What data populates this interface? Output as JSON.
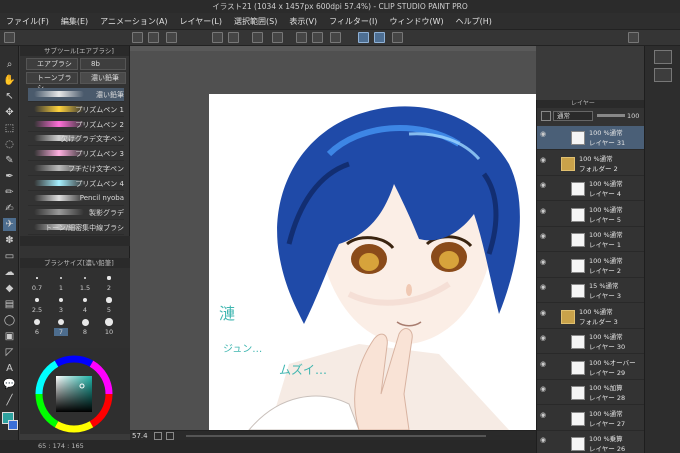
{
  "window": {
    "title": "イラスト21 (1034 x 1457px 600dpi 57.4%) - CLIP STUDIO PAINT PRO"
  },
  "menu": [
    "ファイル(F)",
    "編集(E)",
    "アニメーション(A)",
    "レイヤー(L)",
    "選択範囲(S)",
    "表示(V)",
    "フィルター(I)",
    "ウィンドウ(W)",
    "ヘルプ(H)"
  ],
  "subtool": {
    "header": "サブツール[エアブラシ]",
    "tabs": [
      "エアブラシ",
      "8b",
      "トーンブラシ",
      "濃い鉛筆"
    ],
    "brushes": [
      {
        "name": "濃い鉛筆",
        "selected": true
      },
      {
        "name": "プリズムペン 1"
      },
      {
        "name": "プリズムペン 2"
      },
      {
        "name": "欠けグラデ文字ペン"
      },
      {
        "name": "プリズムペン 3"
      },
      {
        "name": "フチだけ文字ペン"
      },
      {
        "name": "プリズムペン 4"
      },
      {
        "name": "Pencil nyoba"
      },
      {
        "name": "製影グラデ"
      },
      {
        "name": "トーン/細密集中線ブラシ"
      }
    ]
  },
  "brushsize": {
    "header": "ブラシサイズ[濃い鉛筆]",
    "values": [
      "0.7",
      "1",
      "1.5",
      "2",
      "2.5",
      "3",
      "4",
      "5",
      "6",
      "7",
      "8",
      "10"
    ]
  },
  "color": {
    "rgb_readout": "65 : 174 : 165",
    "main_color": "#2ea29f",
    "sub_color": "#3a6fd8"
  },
  "canvas": {
    "zoom": "57.4",
    "handwriting_1": "漣",
    "handwriting_2": "ジュン…",
    "handwriting_3": "ムズイ…"
  },
  "layers": {
    "header": "レイヤー",
    "blend_mode": "通常",
    "opacity": "100",
    "rows": [
      {
        "top": "100 %通常",
        "name": "レイヤー 31",
        "selected": true
      },
      {
        "top": "100 %通常",
        "name": "フォルダー 2",
        "folder": true
      },
      {
        "top": "100 %通常",
        "name": "レイヤー 4"
      },
      {
        "top": "100 %通常",
        "name": "レイヤー 5"
      },
      {
        "top": "100 %通常",
        "name": "レイヤー 1"
      },
      {
        "top": "100 %通常",
        "name": "レイヤー 2"
      },
      {
        "top": "15 %通常",
        "name": "レイヤー 3"
      },
      {
        "top": "100 %通常",
        "name": "フォルダー 3",
        "folder": true
      },
      {
        "top": "100 %通常",
        "name": "レイヤー 30"
      },
      {
        "top": "100 %オーバー",
        "name": "レイヤー 29"
      },
      {
        "top": "100 %加算",
        "name": "レイヤー 28"
      },
      {
        "top": "100 %通常",
        "name": "レイヤー 27"
      },
      {
        "top": "100 %乗算",
        "name": "レイヤー 26"
      }
    ]
  }
}
